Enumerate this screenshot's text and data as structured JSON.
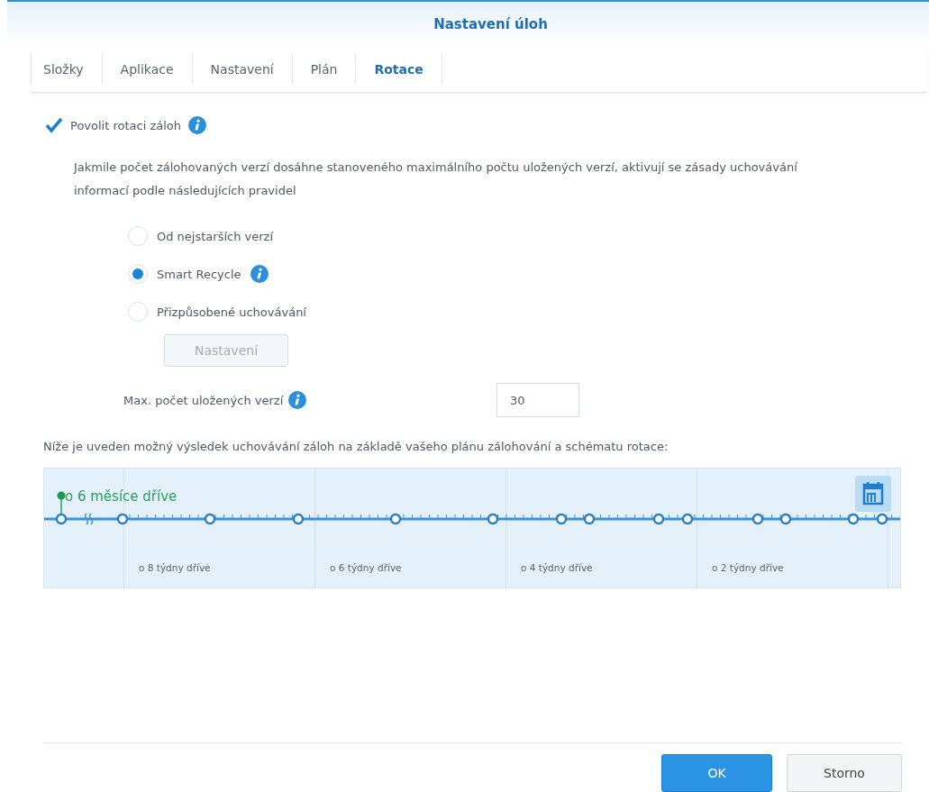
{
  "window": {
    "title": "Nastavení úloh"
  },
  "tabs": [
    {
      "label": "Složky",
      "selected": false
    },
    {
      "label": "Aplikace",
      "selected": false
    },
    {
      "label": "Nastavení",
      "selected": false
    },
    {
      "label": "Plán",
      "selected": false
    },
    {
      "label": "Rotace",
      "selected": true
    }
  ],
  "enable_rotation": {
    "label": "Povolit rotaci záloh",
    "checked": true
  },
  "description": "Jakmile počet zálohovaných verzí dosáhne stanoveného maximálního počtu uložených verzí, aktivují se zásady uchovávání informací podle následujících pravidel",
  "options": [
    {
      "label": "Od nejstarších verzí",
      "selected": false,
      "info": false
    },
    {
      "label": "Smart Recycle",
      "selected": true,
      "info": true
    },
    {
      "label": "Přizpůsobené uchovávání",
      "selected": false,
      "info": false
    }
  ],
  "settings_button": {
    "label": "Nastavení",
    "disabled": true
  },
  "max_versions": {
    "label": "Max. počet uložených verzí",
    "value": "30"
  },
  "result_note": "Níže je uveden možný výsledek uchovávání záloh na základě vašeho plánu zálohování a schématu rotace:",
  "timeline": {
    "start_label": "o 6 měsíce dříve",
    "week_labels": [
      "o 8 týdny dříve",
      "o 6 týdny dříve",
      "o 4 týdny dříve",
      "o 2 týdny dříve"
    ]
  },
  "buttons": [
    {
      "label": "OK",
      "kind": "primary"
    },
    {
      "label": "Storno",
      "kind": "secondary"
    }
  ]
}
